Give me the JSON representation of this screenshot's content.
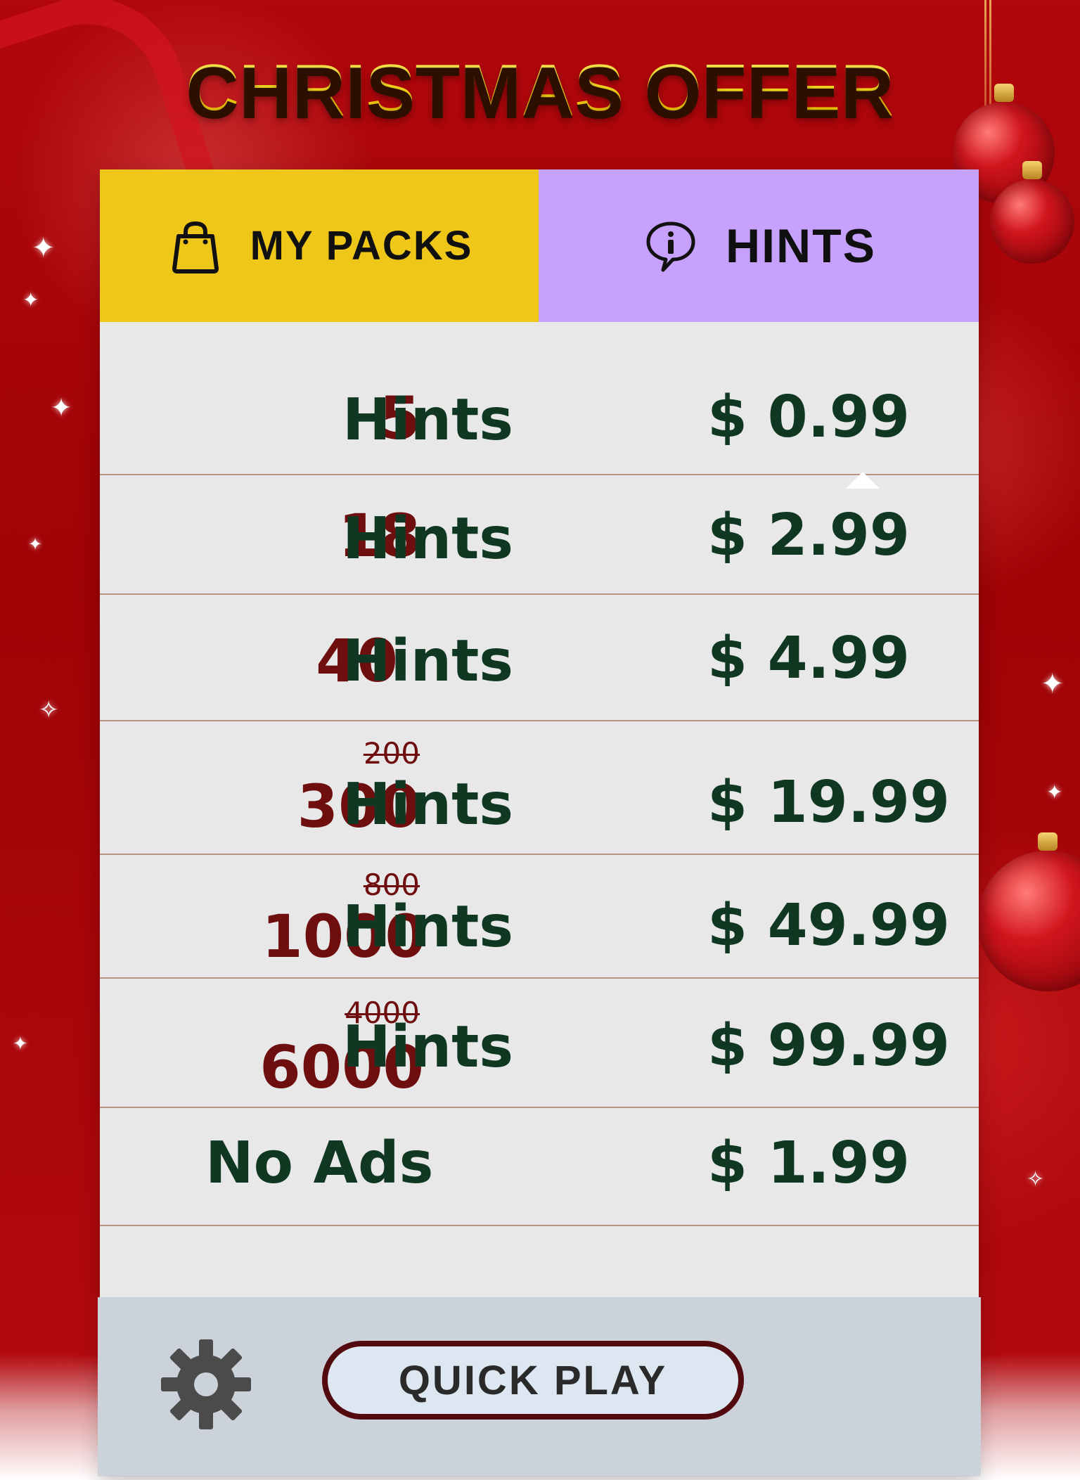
{
  "title": "CHRISTMAS OFFER",
  "tabs": [
    {
      "label": "MY PACKS",
      "icon": "shopping-bag-icon",
      "color": "#eec718"
    },
    {
      "label": "HINTS",
      "icon": "info-bubble-icon",
      "color": "#c6a1fd"
    }
  ],
  "offers": [
    {
      "quantity": "5",
      "old_quantity": "",
      "unit": "Hints",
      "price": "$ 0.99"
    },
    {
      "quantity": "18",
      "old_quantity": "",
      "unit": "Hints",
      "price": "$ 2.99"
    },
    {
      "quantity": "40",
      "old_quantity": "",
      "unit": "Hints",
      "price": "$ 4.99"
    },
    {
      "quantity": "300",
      "old_quantity": "200",
      "unit": "Hints",
      "price": "$ 19.99"
    },
    {
      "quantity": "1000",
      "old_quantity": "800",
      "unit": "Hints",
      "price": "$ 49.99"
    },
    {
      "quantity": "6000",
      "old_quantity": "4000",
      "unit": "Hints",
      "price": "$ 99.99"
    },
    {
      "quantity": "",
      "old_quantity": "",
      "unit": "No Ads",
      "price": "$ 1.99"
    }
  ],
  "footer": {
    "settings_icon": "gear-icon",
    "quick_play_label": "QUICK PLAY"
  },
  "colors": {
    "background_red": "#b1070c",
    "title_gold": "#f7d80d",
    "row_text_green": "#0f3722",
    "row_text_red": "#6f0e0e",
    "footer_gray": "#ccd2d9"
  }
}
